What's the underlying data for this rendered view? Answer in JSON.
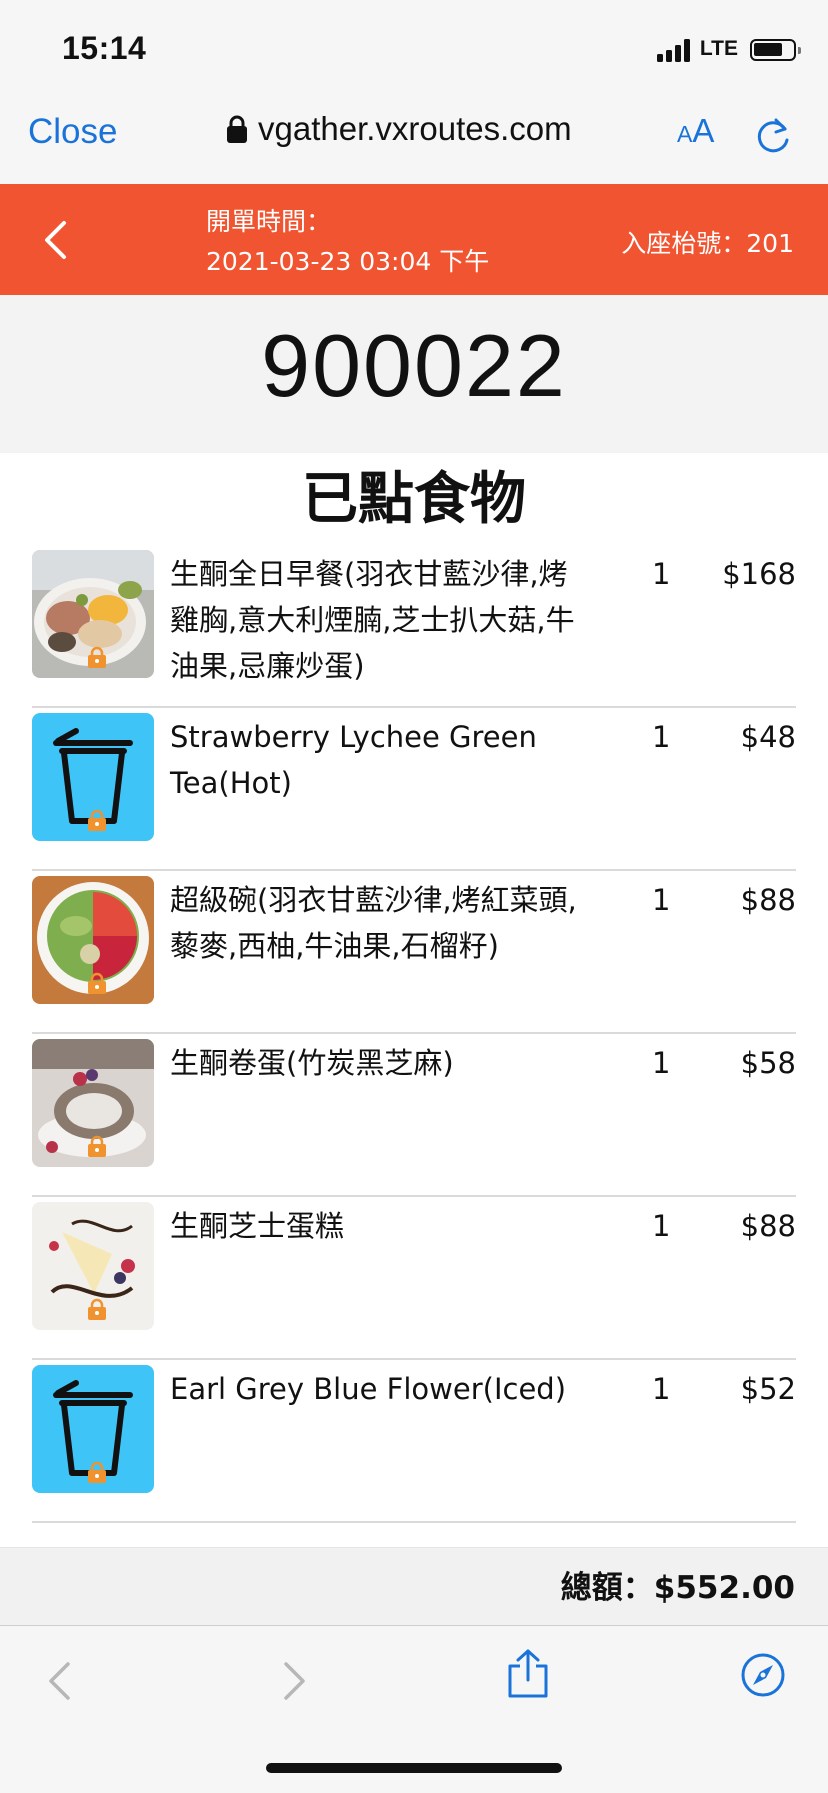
{
  "status_bar": {
    "time": "15:14",
    "network": "LTE",
    "battery_level": 0.75
  },
  "browser": {
    "close_label": "Close",
    "url": "vgather.vxroutes.com",
    "text_size_small": "A",
    "text_size_big": "A",
    "icons": [
      "lock-icon",
      "reload-icon"
    ]
  },
  "header": {
    "open_time_label": "開單時間：",
    "open_time_value": "2021-03-23 03:04 下午",
    "table_number": "入座枱號：201",
    "back_icon": "chevron-left-icon"
  },
  "order": {
    "number": "900022",
    "section_title": "已點食物"
  },
  "items": [
    {
      "name": "生酮全日早餐(羽衣甘藍沙律,烤雞胸,意大利煙腩,芝士扒大菇,牛油果,忌廉炒蛋)",
      "qty": "1",
      "price": "$168",
      "thumb": "breakfast-plate"
    },
    {
      "name": "Strawberry Lychee Green Tea(Hot)",
      "qty": "1",
      "price": "$48",
      "thumb": "drink-cup-icon"
    },
    {
      "name": "超級碗(羽衣甘藍沙律,烤紅菜頭,藜麥,西柚,牛油果,石榴籽)",
      "qty": "1",
      "price": "$88",
      "thumb": "salad-bowl"
    },
    {
      "name": "生酮卷蛋(竹炭黑芝麻)",
      "qty": "1",
      "price": "$58",
      "thumb": "roll-cake"
    },
    {
      "name": "生酮芝士蛋糕",
      "qty": "1",
      "price": "$88",
      "thumb": "cheesecake"
    },
    {
      "name": "Earl Grey Blue Flower(Iced)",
      "qty": "1",
      "price": "$52",
      "thumb": "drink-cup-icon"
    }
  ],
  "total": {
    "text": "總額：$552.00"
  },
  "toolbar": {
    "icons": [
      "back-arrow-icon",
      "forward-arrow-icon",
      "share-icon",
      "compass-icon"
    ]
  },
  "colors": {
    "accent": "#f15431",
    "link": "#1a73d8",
    "drink_tile": "#3fc4f7",
    "lock_badge": "#f0932e"
  }
}
